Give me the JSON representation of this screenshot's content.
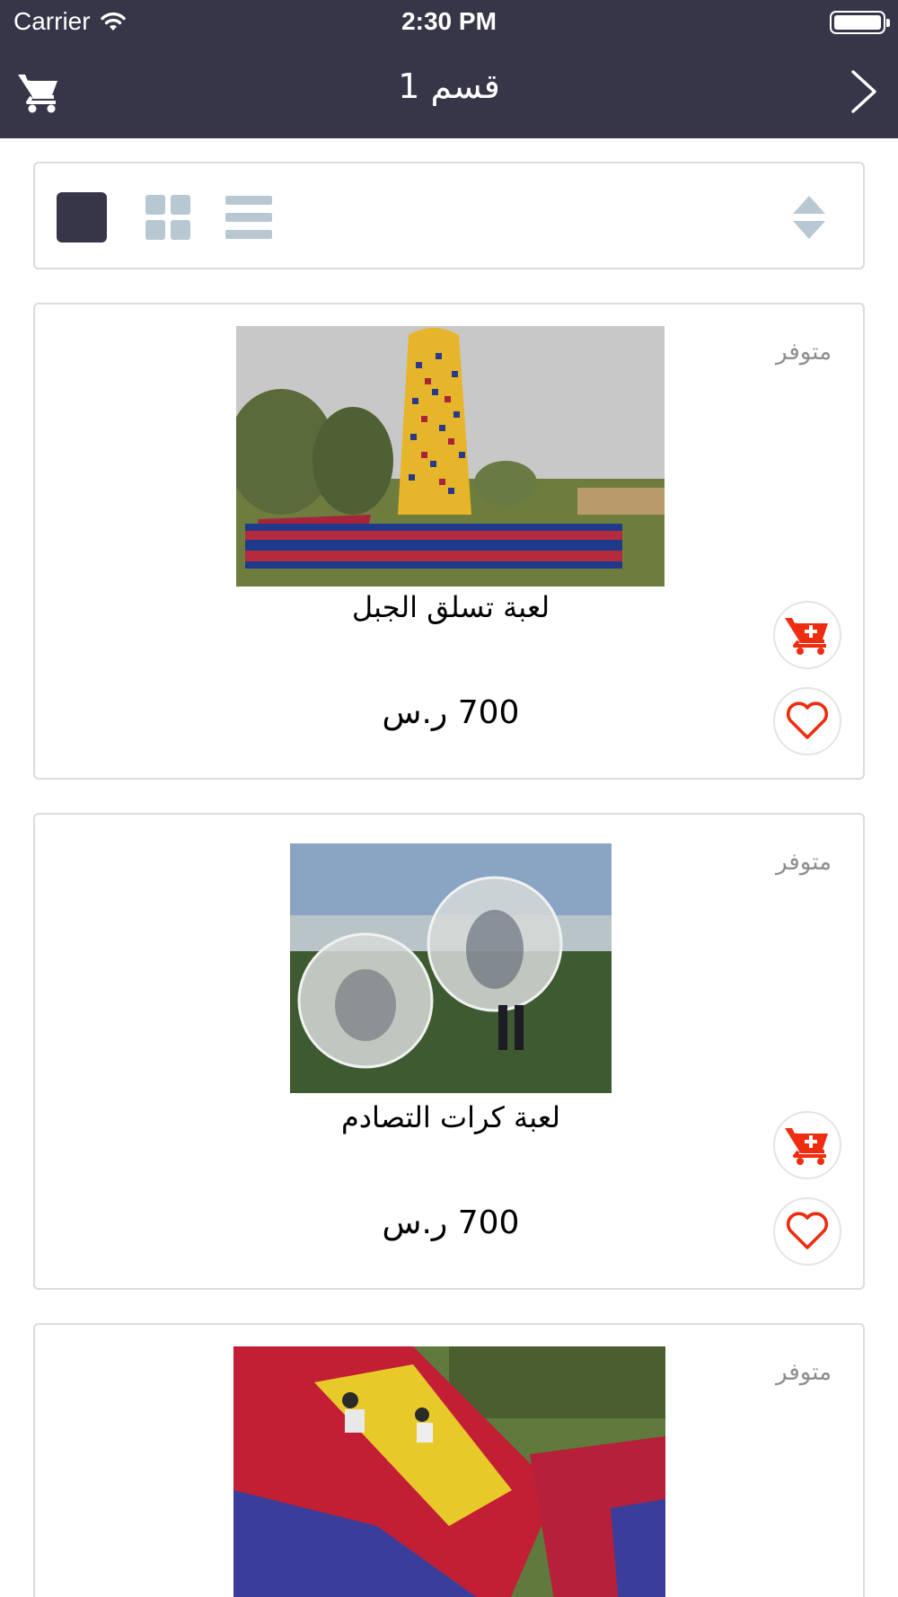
{
  "status_bar": {
    "carrier": "Carrier",
    "time": "2:30 PM"
  },
  "nav": {
    "title": "قسم 1"
  },
  "toolbar": {
    "views": [
      "single",
      "grid",
      "list"
    ],
    "selected_view": "single"
  },
  "products": [
    {
      "availability": "متوفر",
      "name": "لعبة تسلق الجبل",
      "price": "700 ر.س"
    },
    {
      "availability": "متوفر",
      "name": "لعبة كرات التصادم",
      "price": "700 ر.س"
    },
    {
      "availability": "متوفر",
      "name": "",
      "price": ""
    }
  ],
  "colors": {
    "header_bg": "#363648",
    "accent_red": "#ee2d10",
    "icon_inactive": "#b8c8d2",
    "card_border": "#dcdcdc",
    "availability_text": "#8e8e8e"
  },
  "icons": {
    "nav_cart": "cart-icon",
    "nav_forward": "chevron-right-icon",
    "sort": "sort-arrows-icon",
    "add_to_cart": "cart-plus-icon",
    "favorite": "heart-icon"
  }
}
